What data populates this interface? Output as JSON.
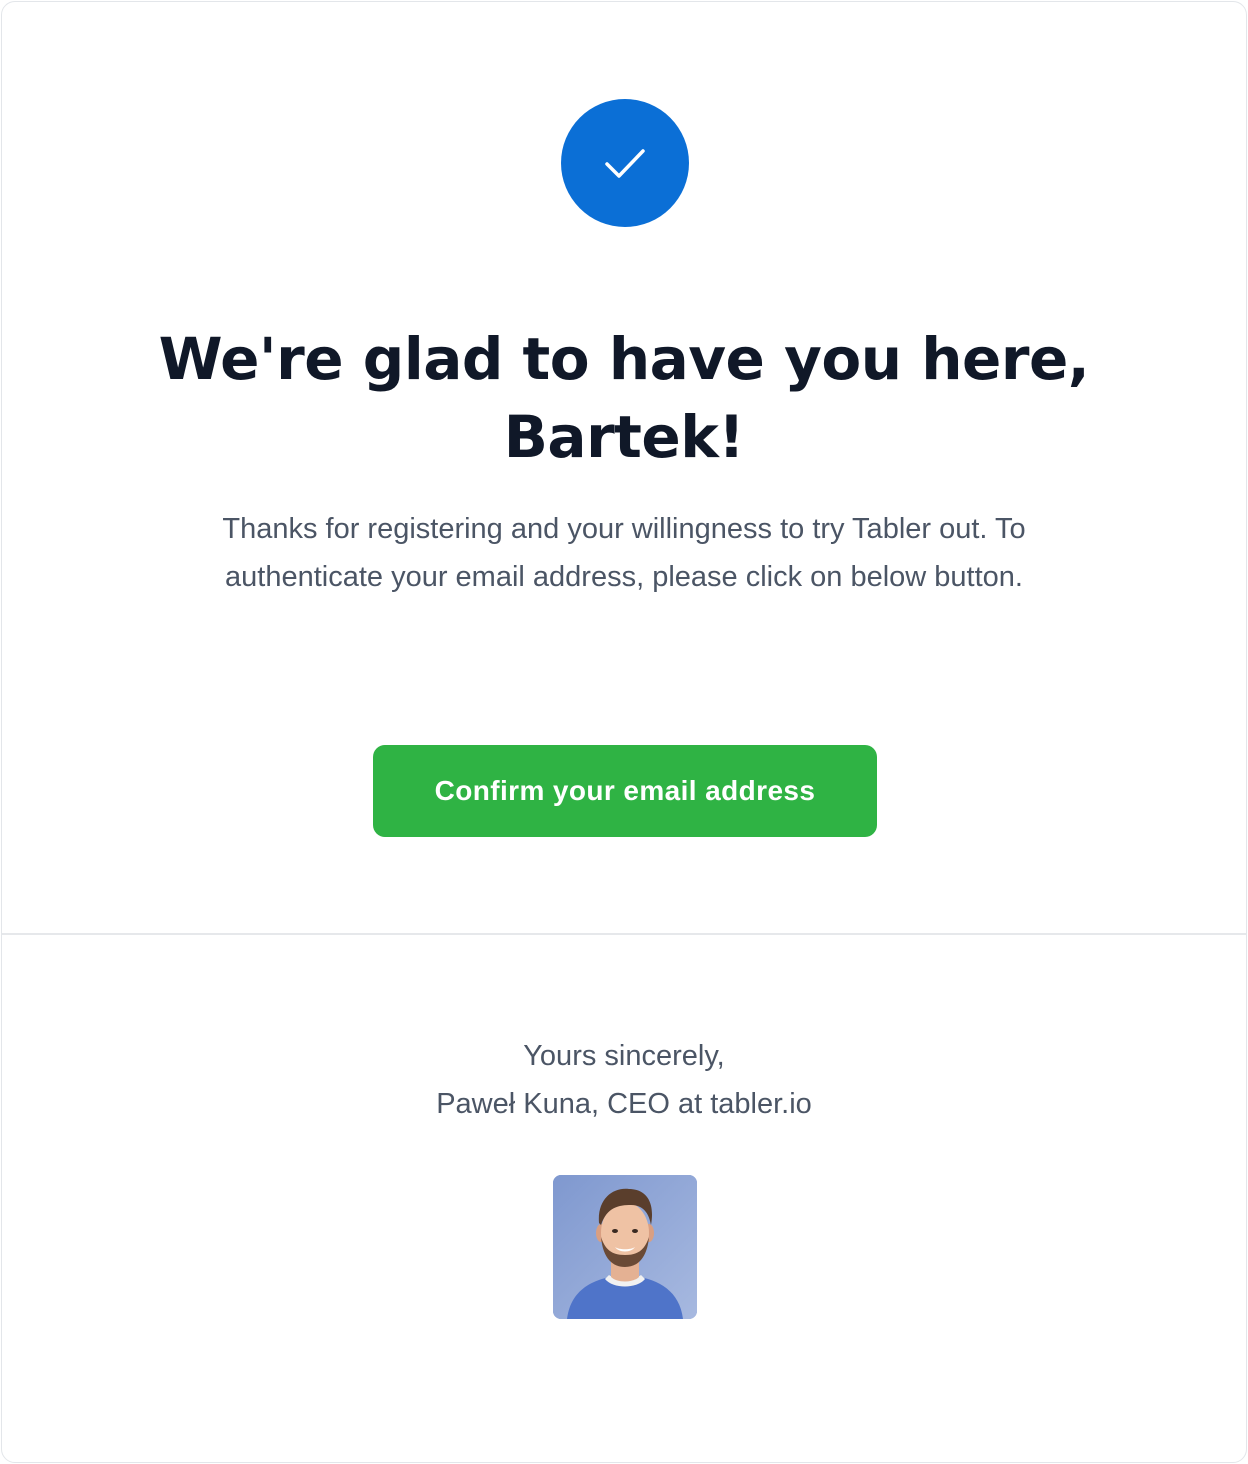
{
  "email": {
    "icon": "check-icon",
    "accent_color": "#0b6fd6",
    "headline": "We're glad to have you here, Bartek!",
    "intro": "Thanks for registering and your willingness to try Tabler out. To authenticate your email address, please click on below button.",
    "confirm_button_label": "Confirm your email address",
    "confirm_button_color": "#2fb344"
  },
  "footer": {
    "closing": "Yours sincerely,",
    "signature": "Paweł Kuna, CEO at tabler.io",
    "avatar_alt": "Paweł Kuna"
  }
}
